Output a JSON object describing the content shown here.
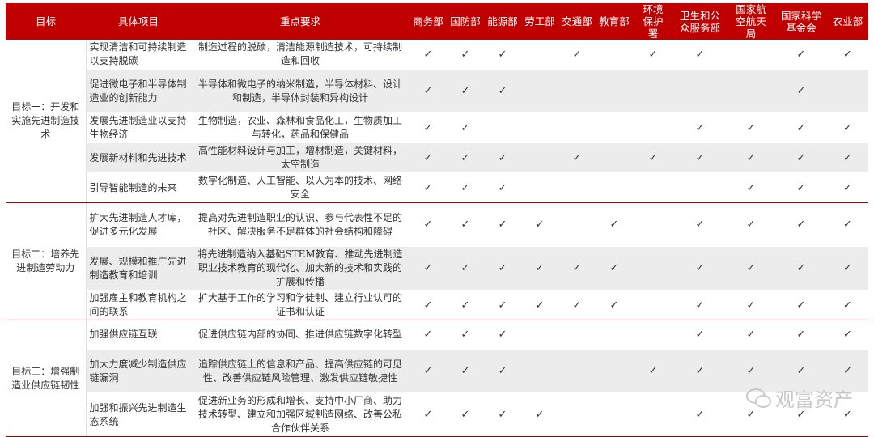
{
  "headers": {
    "goal": "目标",
    "item": "具体项目",
    "key": "重点要求",
    "departments": [
      "商务部",
      "国防部",
      "能源部",
      "劳工部",
      "交通部",
      "教育部",
      "环境保护署",
      "卫生和公众服务部",
      "国家航空航天局",
      "国家科学基金会",
      "农业部"
    ]
  },
  "check_mark": "✓",
  "goals": [
    {
      "label": "目标一：开发和实施先进制造技术",
      "rows": [
        {
          "item": "实现清洁和可持续制造以支持脱碳",
          "key": "制造过程的脱碳，清洁能源制造技术，可持续制造和回收",
          "checks": [
            1,
            1,
            1,
            0,
            1,
            0,
            1,
            1,
            0,
            1,
            1
          ]
        },
        {
          "item": "促进微电子和半导体制造业的创新能力",
          "key": "半导体和微电子的纳米制造，半导体材料、设计和制造，半导体封装和异构设计",
          "checks": [
            1,
            1,
            1,
            0,
            0,
            0,
            0,
            0,
            0,
            1,
            0
          ]
        },
        {
          "item": "发展先进制造业以支持生物经济",
          "key": "生物制造，农业、森林和食品化工，生物质加工与转化，药品和保健品",
          "checks": [
            1,
            1,
            0,
            0,
            0,
            0,
            0,
            1,
            1,
            1,
            1
          ]
        },
        {
          "item": "发展新材料和先进技术",
          "key": "高性能材料设计与加工，增材制造，关键材料，太空制造",
          "checks": [
            1,
            1,
            1,
            0,
            1,
            0,
            1,
            1,
            1,
            1,
            1
          ]
        },
        {
          "item": "引导智能制造的未来",
          "key": "数字化制造、人工智能、以人为本的技术、网络安全",
          "checks": [
            1,
            1,
            1,
            0,
            0,
            0,
            0,
            0,
            1,
            1,
            1
          ]
        }
      ]
    },
    {
      "label": "目标二：培养先进制造劳动力",
      "rows": [
        {
          "item": "扩大先进制造人才库，促进多元化发展",
          "key": "提高对先进制造职业的认识、参与代表性不足的社区、解决服务不足群体的社会结构和障碍",
          "checks": [
            1,
            1,
            1,
            1,
            0,
            1,
            0,
            1,
            1,
            1,
            1
          ]
        },
        {
          "item": "发展、规模和推广先进制造教育和培训",
          "key": "将先进制造纳入基础STEM教育、推动先进制造职业技术教育的现代化、加大新的技术和实践的扩展和传播",
          "checks": [
            1,
            1,
            1,
            1,
            1,
            1,
            0,
            1,
            1,
            1,
            1
          ]
        },
        {
          "item": "加强雇主和教育机构之间的联系",
          "key": "扩大基于工作的学习和学徒制、建立行业认可的证书和认证",
          "checks": [
            1,
            1,
            1,
            1,
            1,
            1,
            0,
            1,
            1,
            1,
            1
          ]
        }
      ]
    },
    {
      "label": "目标三：增强制造业供应链韧性",
      "rows": [
        {
          "item": "加强供应链互联",
          "key": "促进供应链内部的协同、推进供应链数字化转型",
          "checks": [
            1,
            1,
            1,
            0,
            0,
            0,
            0,
            1,
            1,
            1,
            1
          ]
        },
        {
          "item": "加大力度减少制造供应链漏洞",
          "key": "追踪供应链上的信息和产品、提高供应链的可见性、改善供应链风险管理、激发供应链敏捷性",
          "checks": [
            1,
            1,
            1,
            0,
            0,
            0,
            1,
            1,
            1,
            1,
            1
          ]
        },
        {
          "item": "加强和振兴先进制造生态系统",
          "key": "促进新业务的形成和增长、支持中小厂商、助力技术转型、建立和加强区域制造网络、改善公私合作伙伴关系",
          "checks": [
            1,
            1,
            1,
            1,
            0,
            0,
            0,
            1,
            1,
            1,
            1
          ]
        }
      ]
    }
  ],
  "watermark": "观富资产",
  "watermark_icon": "wechat-icon"
}
